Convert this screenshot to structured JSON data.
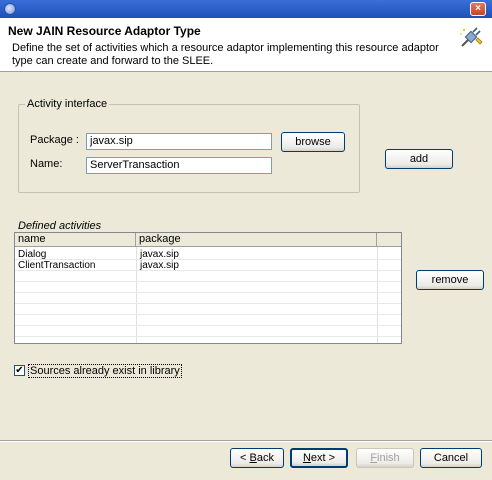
{
  "dialog": {
    "heading": "New JAIN Resource Adaptor Type",
    "description": "Define the set of activities which a resource adaptor implementing this resource adaptor type can create and forward to the SLEE."
  },
  "activity_interface": {
    "legend": "Activity interface",
    "package_label": "Package :",
    "package_value": "javax.sip",
    "name_label": "Name:",
    "name_value": "ServerTransaction",
    "browse_label": "browse",
    "add_label": "add"
  },
  "defined_activities": {
    "legend": "Defined activities",
    "columns": [
      "name",
      "package"
    ],
    "rows": [
      {
        "name": "Dialog",
        "package": "javax.sip"
      },
      {
        "name": "ClientTransaction",
        "package": "javax.sip"
      }
    ],
    "remove_label": "remove"
  },
  "library_checkbox": {
    "label": "Sources already exist in library",
    "checked_mark": "✔"
  },
  "footer": {
    "back_prefix": "< ",
    "back_mnemonic": "B",
    "back_rest": "ack",
    "next_mnemonic": "N",
    "next_rest": "ext >",
    "finish_mnemonic": "F",
    "finish_rest": "inish",
    "cancel_label": "Cancel"
  },
  "colors": {
    "titlebar": "#1e4fb8",
    "dialog_bg": "#ece9d8",
    "button_border": "#003c74"
  },
  "icons": {
    "window": "app-icon",
    "close": "close-icon",
    "wizard": "plug-wizard-icon"
  }
}
